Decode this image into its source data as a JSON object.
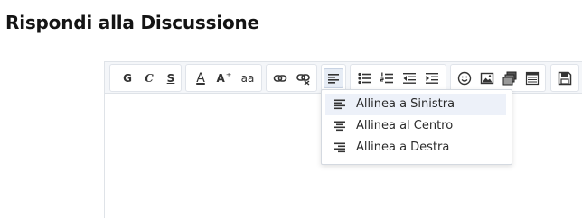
{
  "page": {
    "title": "Rispondi alla Discussione"
  },
  "toolbar": {
    "bold_label": "G",
    "italic_label": "C",
    "underline_label": "S",
    "font_color_label": "A",
    "font_size_label": "A",
    "font_size_sup": "±",
    "font_family_label": "aa",
    "icons": [
      "link-icon",
      "unlink-icon",
      "align-left-icon",
      "bullet-list-icon",
      "numbered-list-icon",
      "outdent-icon",
      "indent-icon",
      "smiley-icon",
      "image-icon",
      "media-icon",
      "table-icon",
      "save-icon"
    ]
  },
  "align_menu": {
    "items": [
      {
        "label": "Allinea a Sinistra",
        "icon": "align-left-icon",
        "highlighted": true
      },
      {
        "label": "Allinea al Centro",
        "icon": "align-center-icon"
      },
      {
        "label": "Allinea a Destra",
        "icon": "align-right-icon"
      }
    ]
  },
  "colors": {
    "toolbar_bg": "#f4f6f9",
    "active_bg": "#e6ecf5",
    "menu_highlight": "#edf1f9"
  }
}
